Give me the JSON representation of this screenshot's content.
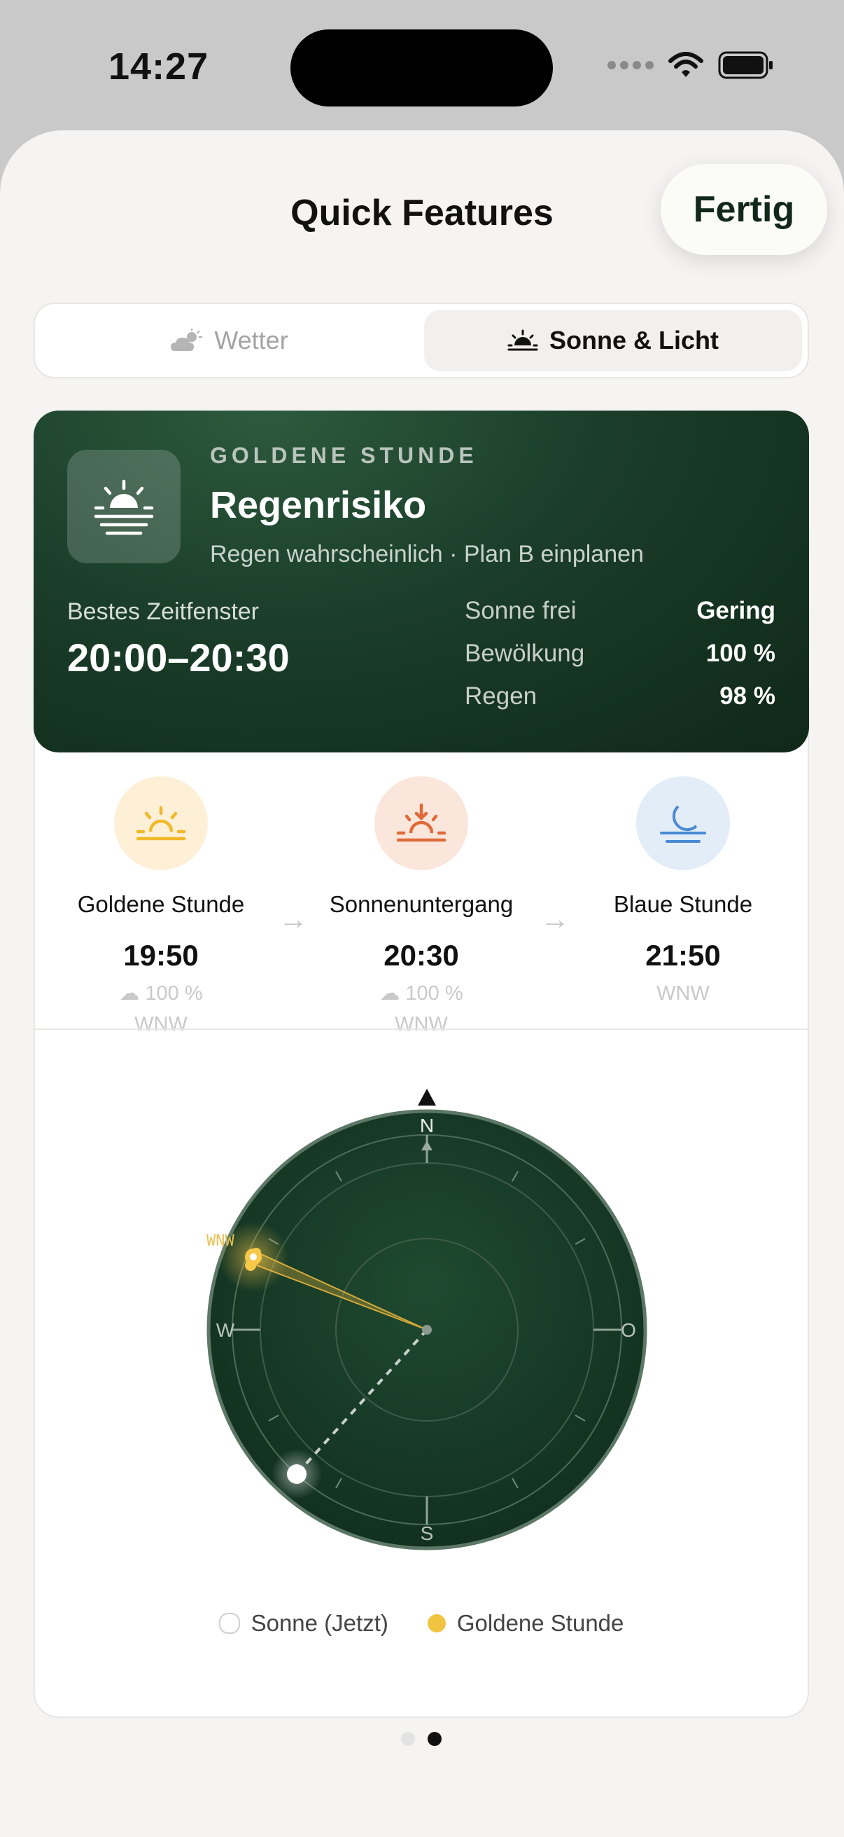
{
  "status_bar": {
    "time": "14:27"
  },
  "header": {
    "title": "Quick Features",
    "done_label": "Fertig"
  },
  "segmented": {
    "tabs": [
      {
        "label": "Wetter",
        "icon": "partly-cloudy-icon",
        "selected": false
      },
      {
        "label": "Sonne & Licht",
        "icon": "sunrise-icon",
        "selected": true
      }
    ]
  },
  "hero": {
    "eyebrow": "GOLDENE STUNDE",
    "title": "Regenrisiko",
    "subtitle": "Regen wahrscheinlich · Plan B einplanen",
    "window_label": "Bestes Zeitfenster",
    "window_value": "20:00–20:30",
    "stats": [
      {
        "key": "Sonne frei",
        "value": "Gering"
      },
      {
        "key": "Bewölkung",
        "value": "100 %"
      },
      {
        "key": "Regen",
        "value": "98 %"
      }
    ],
    "colors": {
      "bg_dark": "#102818",
      "bg_light": "#2d5a3d"
    }
  },
  "phases": [
    {
      "name": "Goldene Stunde",
      "time": "19:50",
      "cloud": "100 %",
      "direction": "WNW",
      "color": "#f0b92a",
      "bg": "#fdf0d7"
    },
    {
      "name": "Sonnenuntergang",
      "time": "20:30",
      "cloud": "100 %",
      "direction": "WNW",
      "color": "#e06a3a",
      "bg": "#fbe6dc"
    },
    {
      "name": "Blaue Stunde",
      "time": "21:50",
      "cloud": "",
      "direction": "WNW",
      "color": "#4a8ad4",
      "bg": "#e3edf8"
    }
  ],
  "compass": {
    "north": "N",
    "south": "S",
    "west": "W",
    "east": "O",
    "golden_label": "WNW"
  },
  "legend": [
    {
      "label": "Sonne (Jetzt)",
      "color": "#ffffff"
    },
    {
      "label": "Goldene Stunde",
      "color": "#f0c341"
    }
  ],
  "pager": {
    "pages": 2,
    "current": 2
  }
}
